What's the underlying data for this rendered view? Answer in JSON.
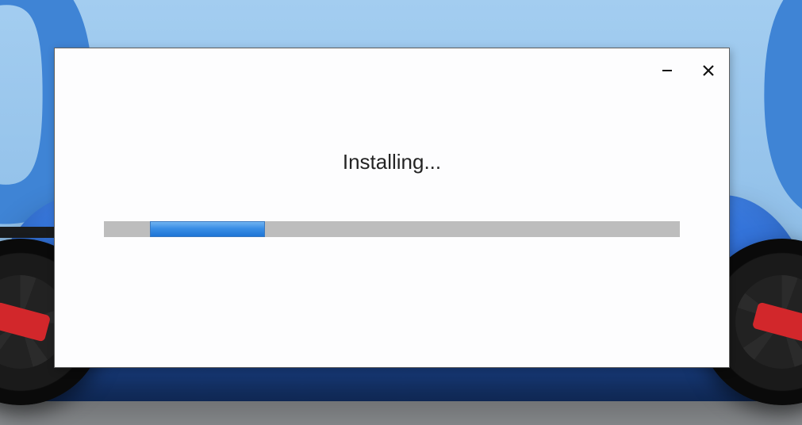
{
  "window": {
    "minimize_icon": "minimize-icon",
    "close_icon": "close-icon"
  },
  "status_text": "Installing...",
  "progress": {
    "indeterminate": true,
    "chunk_start_percent": 8,
    "chunk_width_percent": 20
  },
  "colors": {
    "dialog_bg": "#fdfdfe",
    "dialog_border": "#5f5f5f",
    "track": "#bdbdbd",
    "chunk_top": "#6fb3f1",
    "chunk_bottom": "#1f75d6"
  }
}
